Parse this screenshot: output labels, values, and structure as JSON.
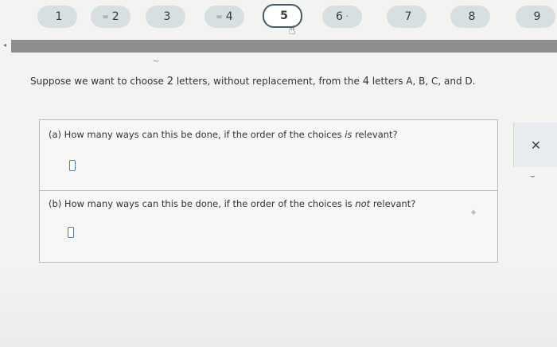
{
  "nav": {
    "steps": [
      {
        "label": "1",
        "marker": ""
      },
      {
        "label": "2",
        "marker": "="
      },
      {
        "label": "3",
        "marker": ""
      },
      {
        "label": "4",
        "marker": "="
      },
      {
        "label": "5",
        "marker": ""
      },
      {
        "label": "6",
        "marker": "·"
      },
      {
        "label": "7",
        "marker": ""
      },
      {
        "label": "8",
        "marker": ""
      },
      {
        "label": "9",
        "marker": ""
      }
    ],
    "active_step": 5
  },
  "progress": {
    "fraction": 1.0,
    "color": "#8e8e8e"
  },
  "problem": {
    "text_before": "Suppose we want to choose ",
    "n1": "2",
    "text_mid": " letters, without replacement, from the ",
    "n2": "4",
    "text_after": " letters A, B, C, and D."
  },
  "questions": {
    "a": {
      "before": "(a) How many ways can this be done, if the order of the choices ",
      "emph": "is",
      "after": " relevant?",
      "answer": ""
    },
    "b": {
      "before": "(b) How many ways can this be done, if the order of the choices is ",
      "emph": "not",
      "after": " relevant?",
      "answer": ""
    }
  },
  "side": {
    "close_symbol": "✕"
  },
  "colors": {
    "accent": "#4f7aa5",
    "step_bg": "#d8dfe1"
  }
}
